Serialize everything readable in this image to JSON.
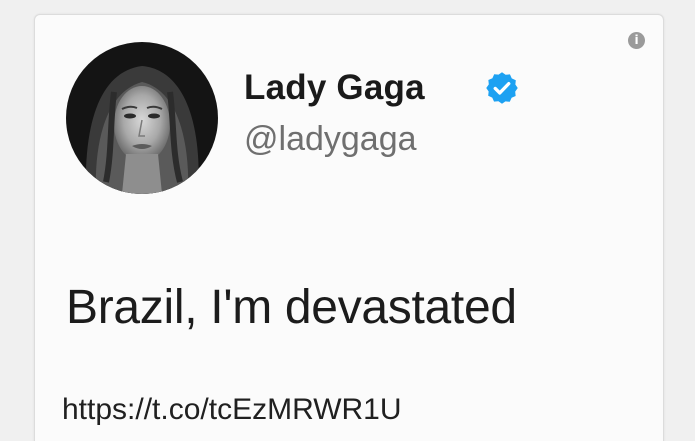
{
  "tweet": {
    "author": {
      "display_name": "Lady Gaga",
      "handle": "@ladygaga",
      "verified": true,
      "verified_badge_color": "#1DA1F2"
    },
    "text": "Brazil, I'm devastated",
    "link": "https://t.co/tcEzMRWR1U",
    "info_icon": {
      "glyph": "i",
      "icon": "info-icon"
    }
  },
  "colors": {
    "background": "#f0f0f0",
    "card": "#fbfbfb",
    "name": "#1a1a1a",
    "handle": "#6f6f6f",
    "body_text": "#1c1c1c"
  }
}
